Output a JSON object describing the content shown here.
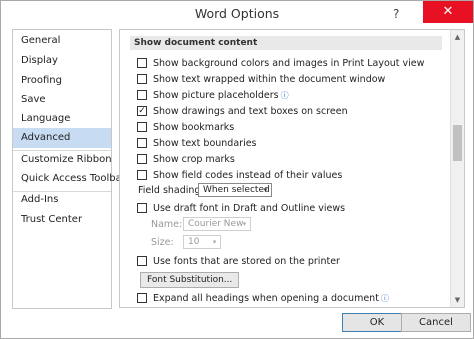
{
  "window": {
    "title": "Word Options",
    "help_glyph": "?",
    "close_glyph": "✕"
  },
  "sidebar": {
    "items": [
      {
        "label": "General"
      },
      {
        "label": "Display"
      },
      {
        "label": "Proofing"
      },
      {
        "label": "Save"
      },
      {
        "label": "Language"
      },
      {
        "label": "Advanced",
        "selected": true
      },
      {
        "label": "Customize Ribbon"
      },
      {
        "label": "Quick Access Toolbar"
      },
      {
        "label": "Add-Ins"
      },
      {
        "label": "Trust Center"
      }
    ]
  },
  "content": {
    "section_title": "Show document content",
    "options": [
      {
        "label": "Show background colors and images in Print Layout view",
        "checked": false
      },
      {
        "label": "Show text wrapped within the document window",
        "checked": false
      },
      {
        "label": "Show picture placeholders",
        "checked": false,
        "info": true
      },
      {
        "label": "Show drawings and text boxes on screen",
        "checked": true
      },
      {
        "label": "Show bookmarks",
        "checked": false
      },
      {
        "label": "Show text boundaries",
        "checked": false
      },
      {
        "label": "Show crop marks",
        "checked": false
      },
      {
        "label": "Show field codes instead of their values",
        "checked": false
      }
    ],
    "field_shading": {
      "label": "Field shading:",
      "value": "When selected"
    },
    "draft_font": {
      "label": "Use draft font in Draft and Outline views",
      "checked": false
    },
    "name": {
      "label": "Name:",
      "value": "Courier New"
    },
    "size": {
      "label": "Size:",
      "value": "10"
    },
    "printer_fonts": {
      "label": "Use fonts that are stored on the printer",
      "checked": false
    },
    "font_substitution_button": "Font Substitution...",
    "expand_headings": {
      "label": "Expand all headings when opening a document",
      "checked": false,
      "info": true
    }
  },
  "icons": {
    "info": "ⓘ",
    "checkmark": "✓",
    "dropdown": "▾",
    "scroll_up": "▲",
    "scroll_down": "▼"
  },
  "buttons": {
    "ok": "OK",
    "cancel": "Cancel"
  }
}
